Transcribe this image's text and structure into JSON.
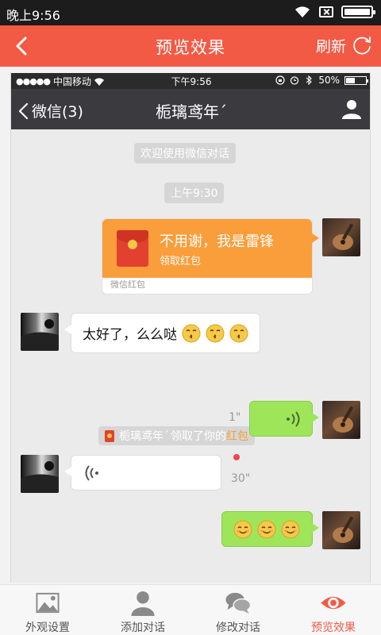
{
  "status_bar": {
    "time": "晚上9:56",
    "battery_level": 1.0
  },
  "header": {
    "title": "预览效果",
    "refresh_label": "刷新"
  },
  "preview": {
    "ios_status": {
      "signal_dots": "●●●●●",
      "carrier": "中国移动",
      "time": "下午9:56",
      "battery": "50%",
      "battery_level": 0.5
    },
    "nav": {
      "back_label": "微信(3)",
      "title": "栀璃鸢年ˊ"
    },
    "messages": {
      "welcome": "欢迎使用微信对话",
      "timestamp": "上午9:30",
      "red_packet": {
        "title": "不用谢，我是雷锋",
        "subtitle": "领取红包",
        "footer": "微信红包"
      },
      "text_reply": {
        "text": "太好了，么么哒",
        "emoji_count": 3
      },
      "notice": {
        "name": "栀璃鸢年ˊ",
        "middle": "领取了你的",
        "link": "红包"
      },
      "voice_sent": {
        "duration": "1\""
      },
      "voice_received": {
        "duration": "30\""
      },
      "emoji_message": {
        "emoji_count": 3
      }
    }
  },
  "tabs": [
    {
      "label": "外观设置",
      "icon": "picture-icon"
    },
    {
      "label": "添加对话",
      "icon": "person-icon"
    },
    {
      "label": "修改对话",
      "icon": "chat-bubbles-icon"
    },
    {
      "label": "预览效果",
      "icon": "eye-icon",
      "active": true
    }
  ],
  "colors": {
    "accent": "#f25a45",
    "red_packet": "#fa9d3b",
    "green_bubble": "#9fe55a",
    "wechat_nav": "#3b3a3f"
  }
}
